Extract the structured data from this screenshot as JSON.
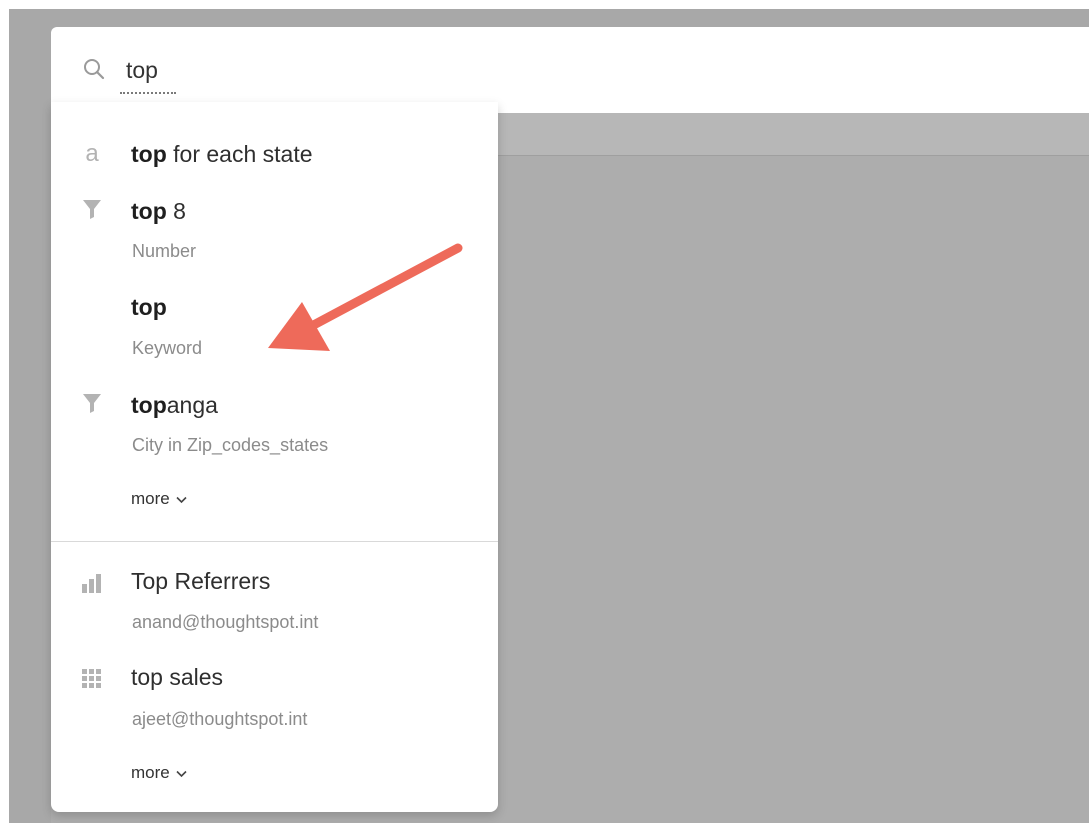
{
  "search": {
    "value": "top"
  },
  "suggestions": [
    {
      "icon": "attribute-a-icon",
      "icon_text": "a",
      "bold": "top",
      "rest": " for each state",
      "sub": ""
    },
    {
      "icon": "filter-icon",
      "bold": "top",
      "rest": " 8",
      "sub": "Number"
    },
    {
      "icon": "",
      "bold": "top",
      "rest": "",
      "sub": "Keyword"
    },
    {
      "icon": "filter-icon",
      "bold": "top",
      "rest": "anga",
      "sub": "City in Zip_codes_states"
    }
  ],
  "more_label": "more",
  "saved": [
    {
      "icon": "bar-chart-icon",
      "title": "Top Referrers",
      "sub": "anand@thoughtspot.int"
    },
    {
      "icon": "table-grid-icon",
      "title": "top sales",
      "sub": "ajeet@thoughtspot.int"
    }
  ],
  "colors": {
    "accent_arrow": "#ee6a5a",
    "icon_grey": "#b3b3b3"
  }
}
